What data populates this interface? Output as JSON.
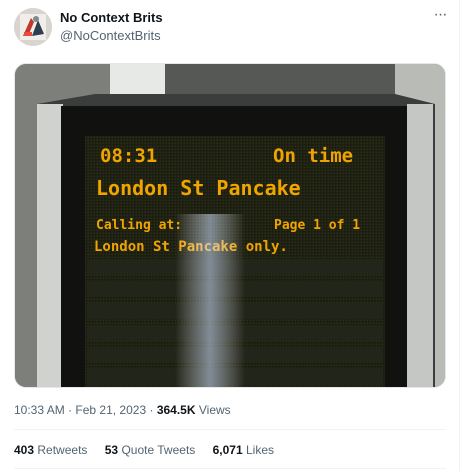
{
  "author": {
    "name": "No Context Brits",
    "handle": "@NoContextBrits"
  },
  "more_menu": "···",
  "media": {
    "board": {
      "time": "08:31",
      "status": "On time",
      "destination": "London St Pancake",
      "calling_label": "Calling at:",
      "page": "Page 1 of 1",
      "calling_points": "London St Pancake only."
    }
  },
  "meta": {
    "time": "10:33 AM",
    "separator": "·",
    "date": "Feb 21, 2023",
    "views_count": "364.5K",
    "views_label": "Views"
  },
  "stats": {
    "retweets_count": "403",
    "retweets_label": "Retweets",
    "quotes_count": "53",
    "quotes_label": "Quote Tweets",
    "likes_count": "6,071",
    "likes_label": "Likes"
  }
}
